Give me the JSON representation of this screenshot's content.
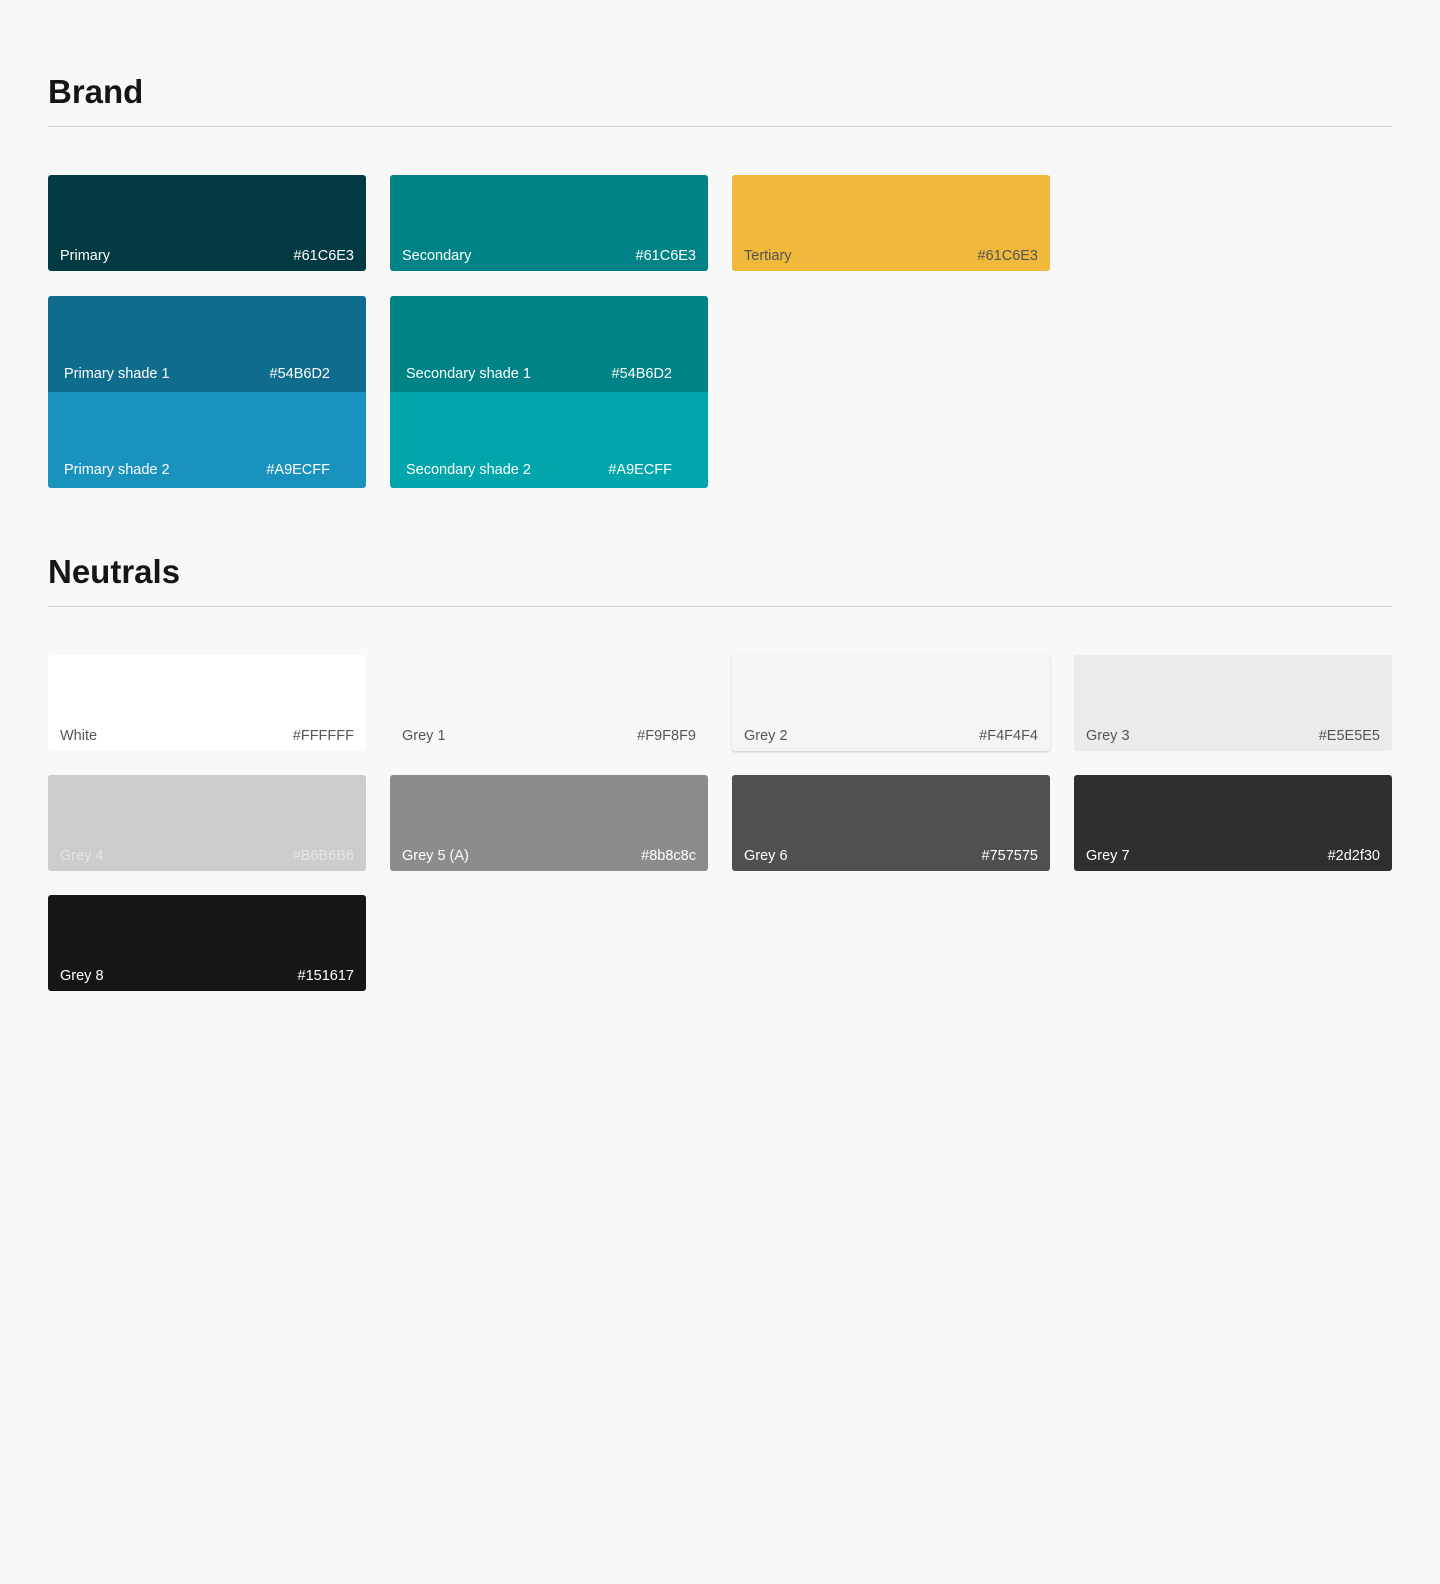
{
  "brand": {
    "title": "Brand",
    "primary": {
      "label": "Primary",
      "hex": "#61C6E3",
      "color": "#023a43"
    },
    "secondary": {
      "label": "Secondary",
      "hex": "#61C6E3",
      "color": "#008387"
    },
    "tertiary": {
      "label": "Tertiary",
      "hex": "#61C6E3",
      "color": "#f0b93b"
    },
    "primary_shade_1": {
      "label": "Primary shade 1",
      "hex": "#54B6D2",
      "color": "#106c8c"
    },
    "primary_shade_2": {
      "label": "Primary shade 2",
      "hex": "#A9ECFF",
      "color": "#1993be"
    },
    "secondary_shade_1": {
      "label": "Secondary shade 1",
      "hex": "#54B6D2",
      "color": "#008387"
    },
    "secondary_shade_2": {
      "label": "Secondary shade 2",
      "hex": "#A9ECFF",
      "color": "#00a6ac"
    }
  },
  "neutrals": {
    "title": "Neutrals",
    "white": {
      "label": "White",
      "hex": "#FFFFFF",
      "color": "#ffffff"
    },
    "grey1": {
      "label": "Grey 1",
      "hex": "#F9F8F9",
      "color": "#f9f8f8"
    },
    "grey2": {
      "label": "Grey 2",
      "hex": "#F4F4F4",
      "color": "#f6f5f4"
    },
    "grey3": {
      "label": "Grey 3",
      "hex": "#E5E5E5",
      "color": "#ebebeb"
    },
    "grey4": {
      "label": "Grey 4",
      "hex": "#B6B6B6",
      "color": "#cccccc"
    },
    "grey5": {
      "label": "Grey 5 (A)",
      "hex": "#8b8c8c",
      "color": "#8b8c8c"
    },
    "grey6": {
      "label": "Grey 6",
      "hex": "#757575",
      "color": "#505050"
    },
    "grey7": {
      "label": "Grey 7",
      "hex": "#2d2f30",
      "color": "#2d2f30"
    },
    "grey8": {
      "label": "Grey 8",
      "hex": "#151617",
      "color": "#151617"
    }
  }
}
